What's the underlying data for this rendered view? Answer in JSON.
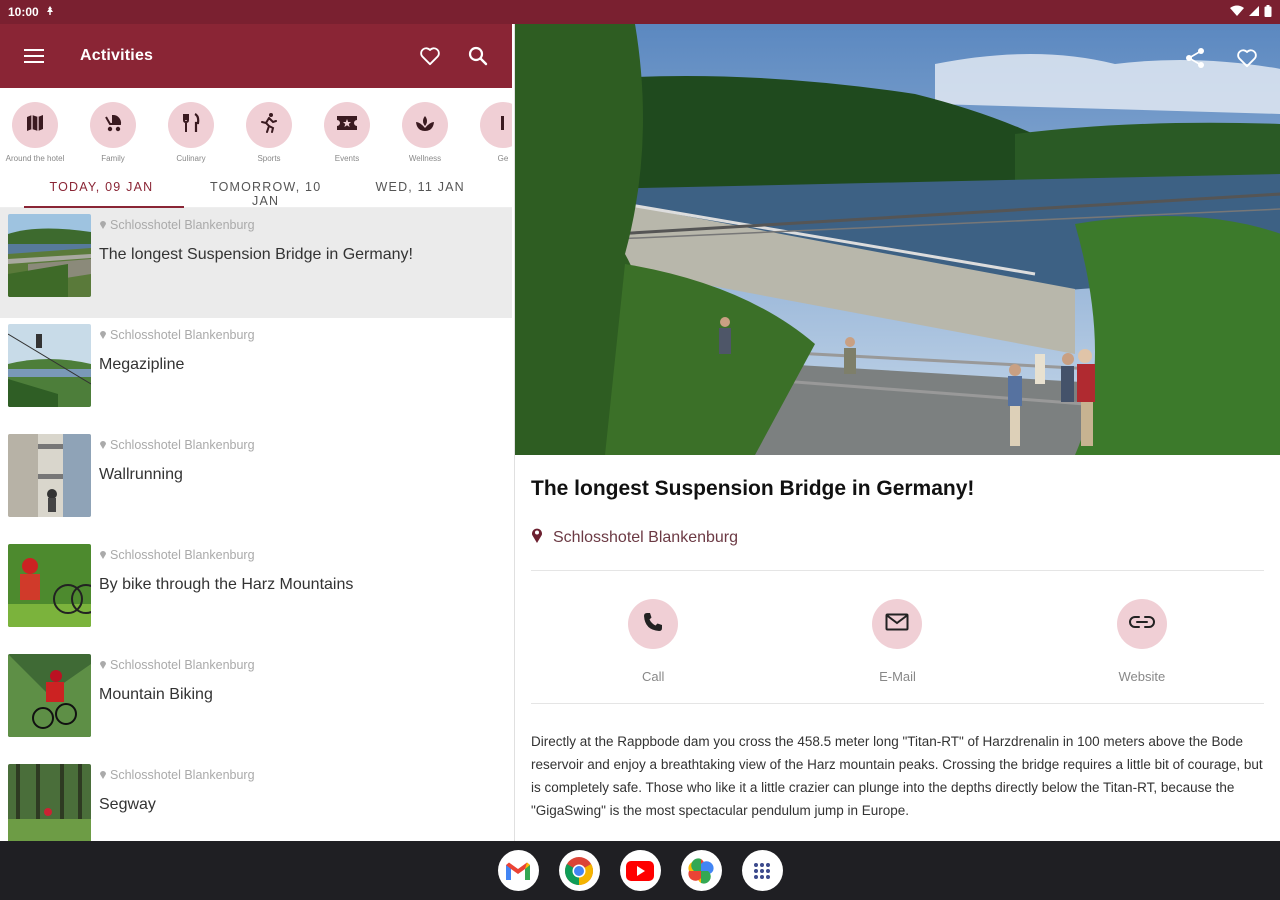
{
  "status": {
    "time": "10:00"
  },
  "appbar": {
    "title": "Activities"
  },
  "categories": [
    {
      "label": "Around the hotel",
      "icon": "map-icon"
    },
    {
      "label": "Family",
      "icon": "stroller-icon"
    },
    {
      "label": "Culinary",
      "icon": "cutlery-icon"
    },
    {
      "label": "Sports",
      "icon": "running-icon"
    },
    {
      "label": "Events",
      "icon": "ticket-icon"
    },
    {
      "label": "Wellness",
      "icon": "spa-icon"
    },
    {
      "label": "Ge",
      "icon": "more-icon"
    }
  ],
  "date_tabs": [
    {
      "label": "TODAY, 09 JAN",
      "active": true
    },
    {
      "label": "TOMORROW, 10 JAN",
      "active": false
    },
    {
      "label": "WED, 11 JAN",
      "active": false
    }
  ],
  "activities": [
    {
      "location": "Schlosshotel Blankenburg",
      "name": "The longest Suspension Bridge in Germany!"
    },
    {
      "location": "Schlosshotel Blankenburg",
      "name": "Megazipline"
    },
    {
      "location": "Schlosshotel Blankenburg",
      "name": "Wallrunning"
    },
    {
      "location": "Schlosshotel Blankenburg",
      "name": "By bike through the Harz Mountains"
    },
    {
      "location": "Schlosshotel Blankenburg",
      "name": "Mountain Biking"
    },
    {
      "location": "Schlosshotel Blankenburg",
      "name": "Segway"
    }
  ],
  "detail": {
    "title": "The longest Suspension Bridge in Germany!",
    "location": "Schlosshotel Blankenburg",
    "contacts": {
      "call": "Call",
      "email": "E-Mail",
      "website": "Website"
    },
    "description": "Directly at the Rappbode dam you cross the 458.5 meter long \"Titan-RT\" of Harzdrenalin in 100 meters above the Bode reservoir and enjoy a breathtaking view of the Harz mountain peaks. Crossing the bridge requires a little bit of courage, but is completely safe. Those who like it a little crazier can plunge into the depths directly below the Titan-RT, because the \"GigaSwing\" is the most spectacular pendulum jump in Europe."
  },
  "colors": {
    "primary": "#8a2535",
    "statusbar": "#7a2030",
    "accent_soft": "#f0cfd5"
  }
}
